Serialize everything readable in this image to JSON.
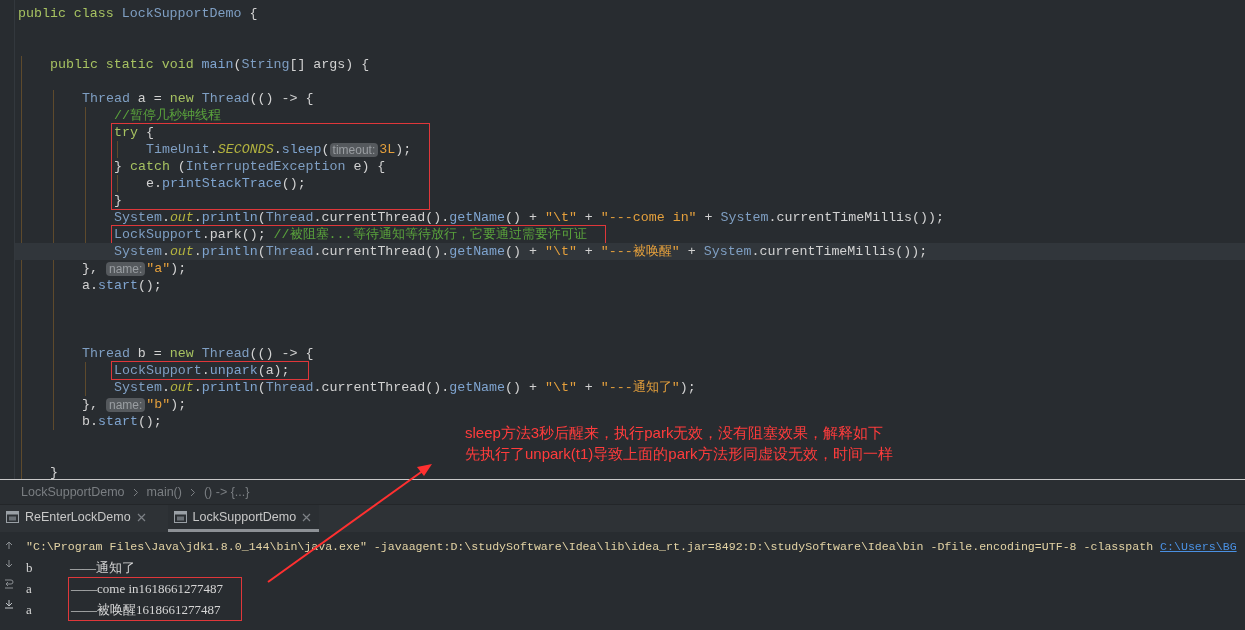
{
  "editor": {
    "lines": [
      {
        "tokens": [
          {
            "kind": "kw",
            "text": "public class "
          },
          {
            "kind": "type",
            "text": "LockSupportDemo"
          },
          {
            "kind": "plain",
            "text": " {"
          }
        ]
      },
      {
        "kind": "blank"
      },
      {
        "kind": "blank"
      },
      {
        "kind": "block",
        "children": [
          {
            "tokens": [
              {
                "kind": "kw",
                "text": "public static void "
              },
              {
                "kind": "method",
                "text": "main"
              },
              {
                "kind": "plain",
                "text": "("
              },
              {
                "kind": "type",
                "text": "String"
              },
              {
                "kind": "plain",
                "text": "[] args) {"
              }
            ]
          },
          {
            "kind": "blank"
          },
          {
            "kind": "block",
            "children": [
              {
                "tokens": [
                  {
                    "kind": "type",
                    "text": "Thread"
                  },
                  {
                    "kind": "plain",
                    "text": " a = "
                  },
                  {
                    "kind": "kw",
                    "text": "new "
                  },
                  {
                    "kind": "type",
                    "text": "Thread"
                  },
                  {
                    "kind": "plain",
                    "text": "(() -> {"
                  }
                ]
              },
              {
                "kind": "block",
                "children": [
                  {
                    "tokens": [
                      {
                        "kind": "comment",
                        "text": "//暂停几秒钟线程"
                      }
                    ]
                  },
                  {
                    "kind": "boxed",
                    "children": [
                      {
                        "tokens": [
                          {
                            "kind": "kw",
                            "text": "try"
                          },
                          {
                            "kind": "plain",
                            "text": " {"
                          }
                        ]
                      },
                      {
                        "kind": "block",
                        "children": [
                          {
                            "tokens": [
                              {
                                "kind": "type",
                                "text": "TimeUnit"
                              },
                              {
                                "kind": "plain",
                                "text": "."
                              },
                              {
                                "kind": "field",
                                "text": "SECONDS"
                              },
                              {
                                "kind": "plain",
                                "text": "."
                              },
                              {
                                "kind": "method",
                                "text": "sleep"
                              },
                              {
                                "kind": "plain",
                                "text": "("
                              },
                              {
                                "kind": "hint",
                                "text": "timeout:"
                              },
                              {
                                "kind": "num",
                                "text": "3L"
                              },
                              {
                                "kind": "plain",
                                "text": ");"
                              }
                            ]
                          }
                        ]
                      },
                      {
                        "tokens": [
                          {
                            "kind": "plain",
                            "text": "} "
                          },
                          {
                            "kind": "kw",
                            "text": "catch"
                          },
                          {
                            "kind": "plain",
                            "text": " ("
                          },
                          {
                            "kind": "type",
                            "text": "InterruptedException"
                          },
                          {
                            "kind": "plain",
                            "text": " e) {"
                          }
                        ]
                      },
                      {
                        "kind": "block",
                        "children": [
                          {
                            "tokens": [
                              {
                                "kind": "plain",
                                "text": "e."
                              },
                              {
                                "kind": "method",
                                "text": "printStackTrace"
                              },
                              {
                                "kind": "plain",
                                "text": "();"
                              }
                            ]
                          }
                        ]
                      },
                      {
                        "tokens": [
                          {
                            "kind": "plain",
                            "text": "}"
                          }
                        ]
                      }
                    ]
                  },
                  {
                    "tokens": [
                      {
                        "kind": "type",
                        "text": "System"
                      },
                      {
                        "kind": "plain",
                        "text": "."
                      },
                      {
                        "kind": "field",
                        "text": "out"
                      },
                      {
                        "kind": "plain",
                        "text": "."
                      },
                      {
                        "kind": "method",
                        "text": "println"
                      },
                      {
                        "kind": "plain",
                        "text": "("
                      },
                      {
                        "kind": "type",
                        "text": "Thread"
                      },
                      {
                        "kind": "plain",
                        "text": ".currentThread()."
                      },
                      {
                        "kind": "method",
                        "text": "getName"
                      },
                      {
                        "kind": "plain",
                        "text": "() + "
                      },
                      {
                        "kind": "str",
                        "text": "\"\\t\""
                      },
                      {
                        "kind": "plain",
                        "text": " + "
                      },
                      {
                        "kind": "str",
                        "text": "\"---come in\""
                      },
                      {
                        "kind": "plain",
                        "text": " + "
                      },
                      {
                        "kind": "type",
                        "text": "System"
                      },
                      {
                        "kind": "plain",
                        "text": ".currentTimeMillis());"
                      }
                    ]
                  },
                  {
                    "kind": "boxed",
                    "children": [
                      {
                        "tokens": [
                          {
                            "kind": "type",
                            "text": "LockSupport"
                          },
                          {
                            "kind": "plain",
                            "text": ".park(); "
                          },
                          {
                            "kind": "comment",
                            "text": "//被阻塞...等待通知等待放行，它要通过需要许可证"
                          }
                        ]
                      }
                    ]
                  },
                  {
                    "current": true,
                    "tokens": [
                      {
                        "kind": "type",
                        "text": "System"
                      },
                      {
                        "kind": "plain",
                        "text": "."
                      },
                      {
                        "kind": "field",
                        "text": "out"
                      },
                      {
                        "kind": "plain",
                        "text": "."
                      },
                      {
                        "kind": "method",
                        "text": "println"
                      },
                      {
                        "kind": "plain",
                        "text": "("
                      },
                      {
                        "kind": "type",
                        "text": "Thread"
                      },
                      {
                        "kind": "plain",
                        "text": ".currentThread()."
                      },
                      {
                        "kind": "method",
                        "text": "getName"
                      },
                      {
                        "kind": "plain",
                        "text": "() + "
                      },
                      {
                        "kind": "str",
                        "text": "\"\\t\""
                      },
                      {
                        "kind": "plain",
                        "text": " + "
                      },
                      {
                        "kind": "str",
                        "text": "\"---被唤醒\""
                      },
                      {
                        "kind": "plain",
                        "text": " + "
                      },
                      {
                        "kind": "type",
                        "text": "System"
                      },
                      {
                        "kind": "plain",
                        "text": ".currentTimeMillis());"
                      }
                    ]
                  }
                ]
              },
              {
                "tokens": [
                  {
                    "kind": "plain",
                    "text": "}, "
                  },
                  {
                    "kind": "hint",
                    "text": "name:"
                  },
                  {
                    "kind": "str",
                    "text": "\"a\""
                  },
                  {
                    "kind": "plain",
                    "text": ");"
                  }
                ]
              },
              {
                "tokens": [
                  {
                    "kind": "plain",
                    "text": "a."
                  },
                  {
                    "kind": "method",
                    "text": "start"
                  },
                  {
                    "kind": "plain",
                    "text": "();"
                  }
                ]
              },
              {
                "kind": "blank"
              },
              {
                "kind": "blank"
              },
              {
                "kind": "blank"
              },
              {
                "tokens": [
                  {
                    "kind": "type",
                    "text": "Thread"
                  },
                  {
                    "kind": "plain",
                    "text": " b = "
                  },
                  {
                    "kind": "kw",
                    "text": "new "
                  },
                  {
                    "kind": "type",
                    "text": "Thread"
                  },
                  {
                    "kind": "plain",
                    "text": "(() -> {"
                  }
                ]
              },
              {
                "kind": "block",
                "children": [
                  {
                    "kind": "boxed",
                    "children": [
                      {
                        "tokens": [
                          {
                            "kind": "type",
                            "text": "LockSupport"
                          },
                          {
                            "kind": "plain",
                            "text": "."
                          },
                          {
                            "kind": "method",
                            "text": "unpark"
                          },
                          {
                            "kind": "plain",
                            "text": "(a);"
                          }
                        ]
                      }
                    ]
                  },
                  {
                    "tokens": [
                      {
                        "kind": "type",
                        "text": "System"
                      },
                      {
                        "kind": "plain",
                        "text": "."
                      },
                      {
                        "kind": "field",
                        "text": "out"
                      },
                      {
                        "kind": "plain",
                        "text": "."
                      },
                      {
                        "kind": "method",
                        "text": "println"
                      },
                      {
                        "kind": "plain",
                        "text": "("
                      },
                      {
                        "kind": "type",
                        "text": "Thread"
                      },
                      {
                        "kind": "plain",
                        "text": ".currentThread()."
                      },
                      {
                        "kind": "method",
                        "text": "getName"
                      },
                      {
                        "kind": "plain",
                        "text": "() + "
                      },
                      {
                        "kind": "str",
                        "text": "\"\\t\""
                      },
                      {
                        "kind": "plain",
                        "text": " + "
                      },
                      {
                        "kind": "str",
                        "text": "\"---通知了\""
                      },
                      {
                        "kind": "plain",
                        "text": ");"
                      }
                    ]
                  }
                ]
              },
              {
                "tokens": [
                  {
                    "kind": "plain",
                    "text": "}, "
                  },
                  {
                    "kind": "hint",
                    "text": "name:"
                  },
                  {
                    "kind": "str",
                    "text": "\"b\""
                  },
                  {
                    "kind": "plain",
                    "text": ");"
                  }
                ]
              },
              {
                "tokens": [
                  {
                    "kind": "plain",
                    "text": "b."
                  },
                  {
                    "kind": "method",
                    "text": "start"
                  },
                  {
                    "kind": "plain",
                    "text": "();"
                  }
                ]
              }
            ]
          },
          {
            "kind": "blank"
          },
          {
            "kind": "blank"
          },
          {
            "tokens": [
              {
                "kind": "plain",
                "text": "}"
              }
            ]
          }
        ]
      }
    ]
  },
  "annotation": {
    "lines": [
      "sleep方法3秒后醒来，执行park无效，没有阻塞效果，解释如下",
      "先执行了unpark(t1)导致上面的park方法形同虚设无效，时间一样"
    ]
  },
  "breadcrumb": [
    "LockSupportDemo",
    "main()",
    "() -> {...}"
  ],
  "run_tabs": [
    {
      "label": "ReEnterLockDemo",
      "selected": false
    },
    {
      "label": "LockSupportDemo",
      "selected": true
    }
  ],
  "console": {
    "command": "\"C:\\Program Files\\Java\\jdk1.8.0_144\\bin\\java.exe\" -javaagent:D:\\studySoftware\\Idea\\lib\\idea_rt.jar=8492:D:\\studySoftware\\Idea\\bin -Dfile.encoding=UTF-8 -classpath ",
    "command_link": "C:\\Users\\BG",
    "output": [
      {
        "thread": "b",
        "message": "——通知了"
      },
      {
        "kind": "boxed",
        "children": [
          {
            "thread": "a",
            "message": "——come in1618661277487"
          },
          {
            "thread": "a",
            "message": "——被唤醒1618661277487"
          }
        ]
      }
    ]
  }
}
